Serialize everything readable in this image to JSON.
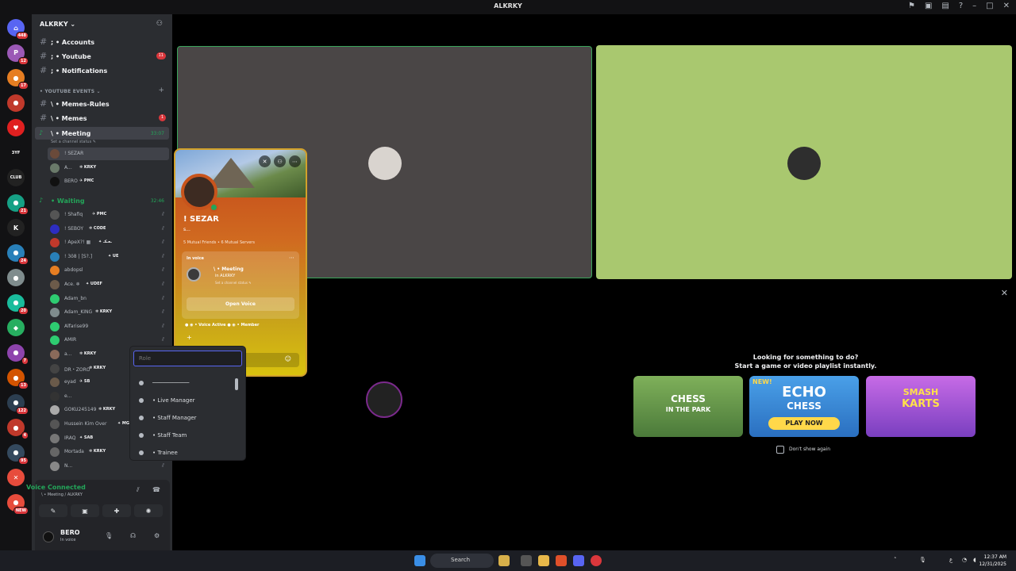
{
  "window": {
    "title": "ALKRKY"
  },
  "titlebar_icons": [
    "inbox-icon",
    "screen-icon",
    "help-icon",
    "minimize-icon",
    "maximize-icon",
    "close-icon"
  ],
  "guilds": [
    {
      "name": "discord-home",
      "badge": "448",
      "color": "#5865f2",
      "glyph": "⌂"
    },
    {
      "name": "server-p",
      "badge": "12",
      "color": "#9b59b6",
      "glyph": "P"
    },
    {
      "name": "server-2",
      "badge": "17",
      "color": "#e67e22",
      "glyph": "●"
    },
    {
      "name": "server-anime",
      "badge": "",
      "color": "#c0392b",
      "glyph": "●"
    },
    {
      "name": "server-heart",
      "badge": "",
      "color": "#e02020",
      "glyph": "♥"
    },
    {
      "name": "server-3yf",
      "badge": "",
      "color": "#121214",
      "glyph": "3YF"
    },
    {
      "name": "server-club",
      "badge": "",
      "color": "#222",
      "glyph": "CLUB"
    },
    {
      "name": "server-4",
      "badge": "21",
      "color": "#16a085",
      "glyph": "●"
    },
    {
      "name": "server-k",
      "badge": "",
      "color": "#222",
      "glyph": "K"
    },
    {
      "name": "server-5",
      "badge": "24",
      "color": "#2980b9",
      "glyph": "●"
    },
    {
      "name": "server-6",
      "badge": "",
      "color": "#7f8c8d",
      "glyph": "●"
    },
    {
      "name": "server-7",
      "badge": "20",
      "color": "#1abc9c",
      "glyph": "●"
    },
    {
      "name": "server-8",
      "badge": "",
      "color": "#27ae60",
      "glyph": "◆"
    },
    {
      "name": "server-9",
      "badge": "7",
      "color": "#8e44ad",
      "glyph": "●"
    },
    {
      "name": "server-10",
      "badge": "13",
      "color": "#d35400",
      "glyph": "●"
    },
    {
      "name": "server-11",
      "badge": "122",
      "color": "#2c3e50",
      "glyph": "●"
    },
    {
      "name": "server-12",
      "badge": "4",
      "color": "#c0392b",
      "glyph": "●"
    },
    {
      "name": "server-13",
      "badge": "95",
      "color": "#34495e",
      "glyph": "●"
    },
    {
      "name": "server-14",
      "badge": "",
      "color": "#e74c3c",
      "glyph": "✕"
    },
    {
      "name": "server-new",
      "badge": "NEW",
      "color": "#e74c3c",
      "glyph": "●"
    }
  ],
  "sidebar": {
    "server_name": "ALKRKY ⌄",
    "channels_top": [
      {
        "label": "; • Accounts",
        "badge": ""
      },
      {
        "label": "; • Youtube",
        "badge": "11"
      },
      {
        "label": "; • Notifications",
        "badge": ""
      }
    ],
    "category": "• YOUTUBE EVENTS ⌄",
    "channels_mid": [
      {
        "label": "\\ • Memes-Rules",
        "badge": ""
      },
      {
        "label": "\\ • Memes",
        "badge": "1"
      }
    ],
    "voice_meeting": {
      "label": "\\ • Meeting",
      "time": "33:07",
      "status": "Set a channel status ✎"
    },
    "meeting_members": [
      {
        "name": "! SEZAR",
        "tag": "",
        "color": "#6a4a3a"
      },
      {
        "name": "A...",
        "tag": "❄ KRKY",
        "color": "#6a7a6a"
      },
      {
        "name": "BERO",
        "tag": "✈ PMC",
        "color": "#111"
      }
    ],
    "voice_waiting": {
      "label": "• Waiting",
      "time": "32:46"
    },
    "waiting_members": [
      {
        "name": "! Shafiq",
        "tag": "✈ PMC",
        "color": "#555"
      },
      {
        "name": "! SEBOY",
        "tag": "❄ CODE",
        "color": "#2d2dc0"
      },
      {
        "name": "! ApeX?! ▦",
        "tag": "✦ ـعـكـ",
        "color": "#c0392b"
      },
      {
        "name": "! 3ö8 | [S?.]",
        "tag": "✦ UE",
        "color": "#2980b9"
      },
      {
        "name": "abdopsl",
        "tag": "",
        "color": "#e67e22"
      },
      {
        "name": "Ace. ❄",
        "tag": "✦ UDEF",
        "color": "#6c5b4a"
      },
      {
        "name": "Adam_bn",
        "tag": "",
        "color": "#2ecc71"
      },
      {
        "name": "Adam_KING",
        "tag": "❄ KRKY",
        "color": "#7f8c8d"
      },
      {
        "name": "Alfarise99",
        "tag": "",
        "color": "#2ecc71"
      },
      {
        "name": "AMIR",
        "tag": "",
        "color": "#2ecc71"
      },
      {
        "name": "a...",
        "tag": "❄ KRKY",
        "color": "#8a6a5a"
      },
      {
        "name": "DR・ZORO",
        "tag": "❄ KRKY",
        "color": "#444"
      },
      {
        "name": "eyad",
        "tag": "✈ SB",
        "color": "#6a5a4a"
      },
      {
        "name": "e...",
        "tag": "",
        "color": "#333"
      },
      {
        "name": "GOKU245149",
        "tag": "❄ KRKY",
        "color": "#aaa"
      },
      {
        "name": "Hussein Kim Over",
        "tag": "✦ MG",
        "color": "#555"
      },
      {
        "name": "IRAQ",
        "tag": "✦ SAB",
        "color": "#777"
      },
      {
        "name": "Mortada",
        "tag": "❄ KRKY",
        "color": "#666"
      },
      {
        "name": "N...",
        "tag": "",
        "color": "#888"
      }
    ]
  },
  "voice_panel": {
    "title": "Voice Connected",
    "sub": "\\ • Meeting / ALKRKY",
    "buttons": [
      "camera-off-icon",
      "screen-share-icon",
      "activity-icon",
      "soundboard-icon"
    ]
  },
  "user_panel": {
    "name": "BERO",
    "status": "In voice"
  },
  "profile": {
    "name": "! SEZAR",
    "sub": "s...",
    "mutual": "5 Mutual Friends • 6 Mutual Servers",
    "in_voice": "In voice",
    "channel": "\\ • Meeting",
    "server": "in ALKRKY",
    "status": "Set a channel status ✎",
    "open_voice": "Open Voice",
    "roles": "● ◉ • Voice Active   ● ◉ • Member"
  },
  "role_dropdown": {
    "placeholder": "Role",
    "options": [
      "───────────",
      "• Live Manager",
      "• Staff Manager",
      "• Staff Team",
      "• Trainee"
    ]
  },
  "activity": {
    "title_line1": "Looking for something to do?",
    "title_line2": "Start a game or video playlist instantly.",
    "cards": [
      {
        "line1": "CHESS",
        "line2": "IN THE PARK",
        "tag": ""
      },
      {
        "line1": "ECHO",
        "line2": "CHESS",
        "tag": "NEW!",
        "cta": "PLAY NOW"
      },
      {
        "line1": "SMASH",
        "line2": "KARTS",
        "tag": ""
      }
    ],
    "dont_show": "Don't show again"
  },
  "taskbar": {
    "search": "Search",
    "time": "12:37 AM",
    "date": "12/31/2025"
  },
  "colors": {
    "accent": "#5865f2",
    "online": "#23a559",
    "danger": "#da373c"
  }
}
